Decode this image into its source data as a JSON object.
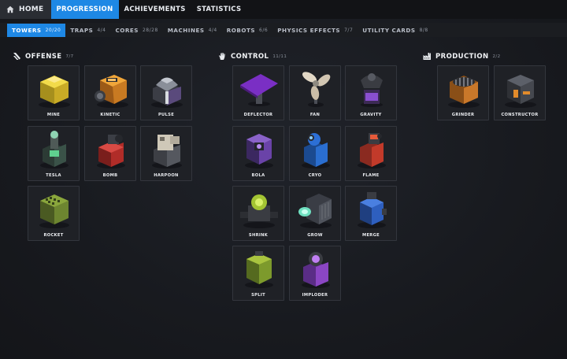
{
  "nav": {
    "home": "HOME",
    "tabs": [
      "PROGRESSION",
      "ACHIEVEMENTS",
      "STATISTICS"
    ],
    "active": "PROGRESSION"
  },
  "subtabs": [
    {
      "label": "TOWERS",
      "count": "20/20",
      "active": true
    },
    {
      "label": "TRAPS",
      "count": "4/4"
    },
    {
      "label": "CORES",
      "count": "28/28"
    },
    {
      "label": "MACHINES",
      "count": "4/4"
    },
    {
      "label": "ROBOTS",
      "count": "6/6"
    },
    {
      "label": "PHYSICS EFFECTS",
      "count": "7/7"
    },
    {
      "label": "UTILITY CARDS",
      "count": "8/8"
    }
  ],
  "sections": {
    "offense": {
      "title": "OFFENSE",
      "count": "7/7",
      "items": [
        "MINE",
        "KINETIC",
        "PULSE",
        "TESLA",
        "BOMB",
        "HARPOON",
        "ROCKET"
      ]
    },
    "control": {
      "title": "CONTROL",
      "count": "11/11",
      "items": [
        "DEFLECTOR",
        "FAN",
        "GRAVITY",
        "BOLA",
        "CRYO",
        "FLAME",
        "SHRINK",
        "GROW",
        "MERGE",
        "SPLIT",
        "IMPLODER"
      ]
    },
    "production": {
      "title": "PRODUCTION",
      "count": "2/2",
      "items": [
        "GRINDER",
        "CONSTRUCTOR"
      ]
    }
  },
  "icons": {
    "home": "home-icon",
    "offense": "sword-slash-icon",
    "control": "hand-icon",
    "production": "factory-icon"
  },
  "colors": {
    "accent": "#1e88e5",
    "mine": "#e2c93a",
    "kinetic": "#e7962c",
    "pulse": "#7f6aa8",
    "tesla": "#3aa57d",
    "bomb": "#c6322e",
    "harpoon": "#c9c2b4",
    "rocket": "#7f9a3a",
    "deflector": "#8a3ec7",
    "fan": "#ddd3c3",
    "gravity": "#6b3ca0",
    "bola": "#7d4fb8",
    "cryo": "#2f78d9",
    "flame": "#d1422c",
    "shrink": "#a9c93a",
    "grow": "#5fd0b0",
    "merge": "#2e62c7",
    "split": "#93b036",
    "imploder": "#a55ad4",
    "grinder": "#d9822b",
    "constructor": "#e0892a"
  }
}
